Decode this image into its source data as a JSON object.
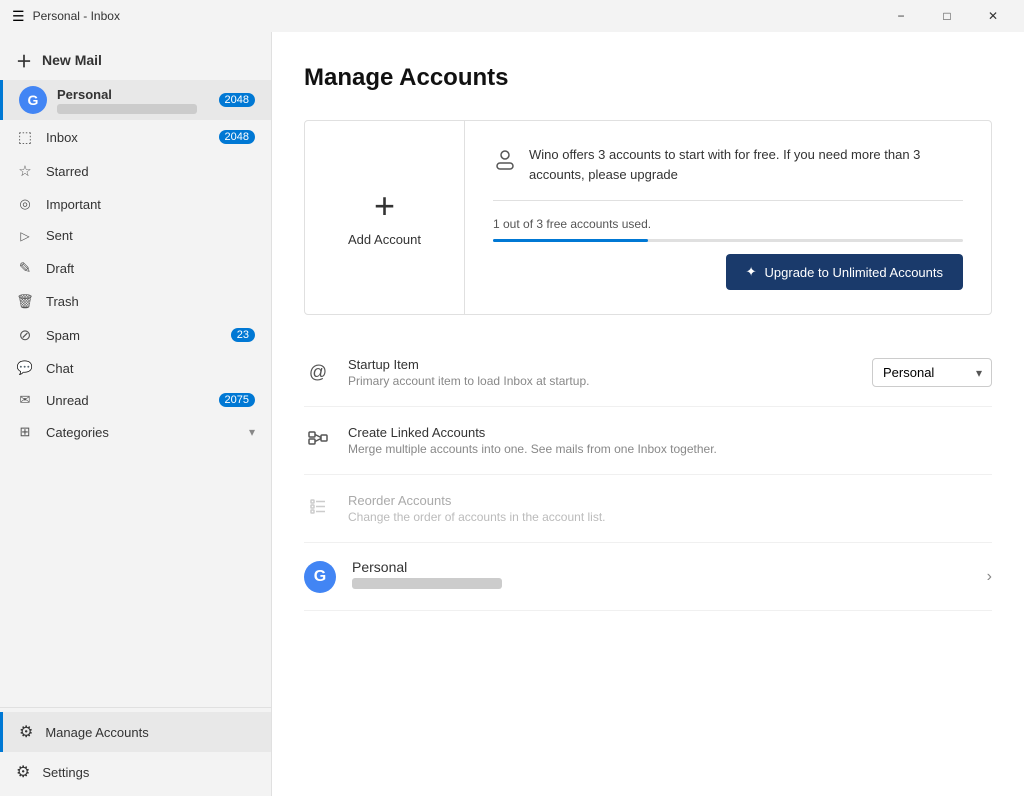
{
  "titlebar": {
    "title": "Personal - Inbox",
    "minimize_label": "−",
    "maximize_label": "□",
    "close_label": "✕"
  },
  "sidebar": {
    "new_mail": "New Mail",
    "account": {
      "name": "Personal",
      "badge": "2048"
    },
    "nav_items": [
      {
        "id": "inbox",
        "icon": "⬚",
        "label": "Inbox",
        "badge": "2048"
      },
      {
        "id": "starred",
        "icon": "☆",
        "label": "Starred",
        "badge": ""
      },
      {
        "id": "important",
        "icon": "⊙",
        "label": "Important",
        "badge": ""
      },
      {
        "id": "sent",
        "icon": "➤",
        "label": "Sent",
        "badge": ""
      },
      {
        "id": "draft",
        "icon": "✎",
        "label": "Draft",
        "badge": ""
      },
      {
        "id": "trash",
        "icon": "🗑",
        "label": "Trash",
        "badge": ""
      },
      {
        "id": "spam",
        "icon": "⊘",
        "label": "Spam",
        "badge": "23"
      },
      {
        "id": "chat",
        "icon": "💬",
        "label": "Chat",
        "badge": ""
      },
      {
        "id": "unread",
        "icon": "✉",
        "label": "Unread",
        "badge": "2075"
      },
      {
        "id": "categories",
        "icon": "⊞",
        "label": "Categories",
        "badge": "",
        "expand": "▾"
      }
    ],
    "manage_accounts": "Manage Accounts",
    "settings": "Settings"
  },
  "main": {
    "page_title": "Manage Accounts",
    "add_account": {
      "icon": "+",
      "label": "Add Account"
    },
    "upgrade": {
      "icon": "👤",
      "description": "Wino offers 3 accounts to start with for free. If you need more than 3 accounts, please upgrade",
      "progress_label": "1 out of 3 free accounts used.",
      "button_label": "Upgrade to Unlimited Accounts",
      "button_icon": "✦"
    },
    "startup_item": {
      "icon": "@",
      "title": "Startup Item",
      "subtitle": "Primary account item to load Inbox at startup.",
      "value": "Personal"
    },
    "create_linked": {
      "icon": "🔗",
      "title": "Create Linked Accounts",
      "subtitle": "Merge multiple accounts into one. See mails from one Inbox together."
    },
    "reorder_accounts": {
      "icon": "≡",
      "title": "Reorder Accounts",
      "subtitle": "Change the order of accounts in the account list.",
      "disabled": true
    },
    "personal_account": {
      "name": "Personal"
    }
  }
}
